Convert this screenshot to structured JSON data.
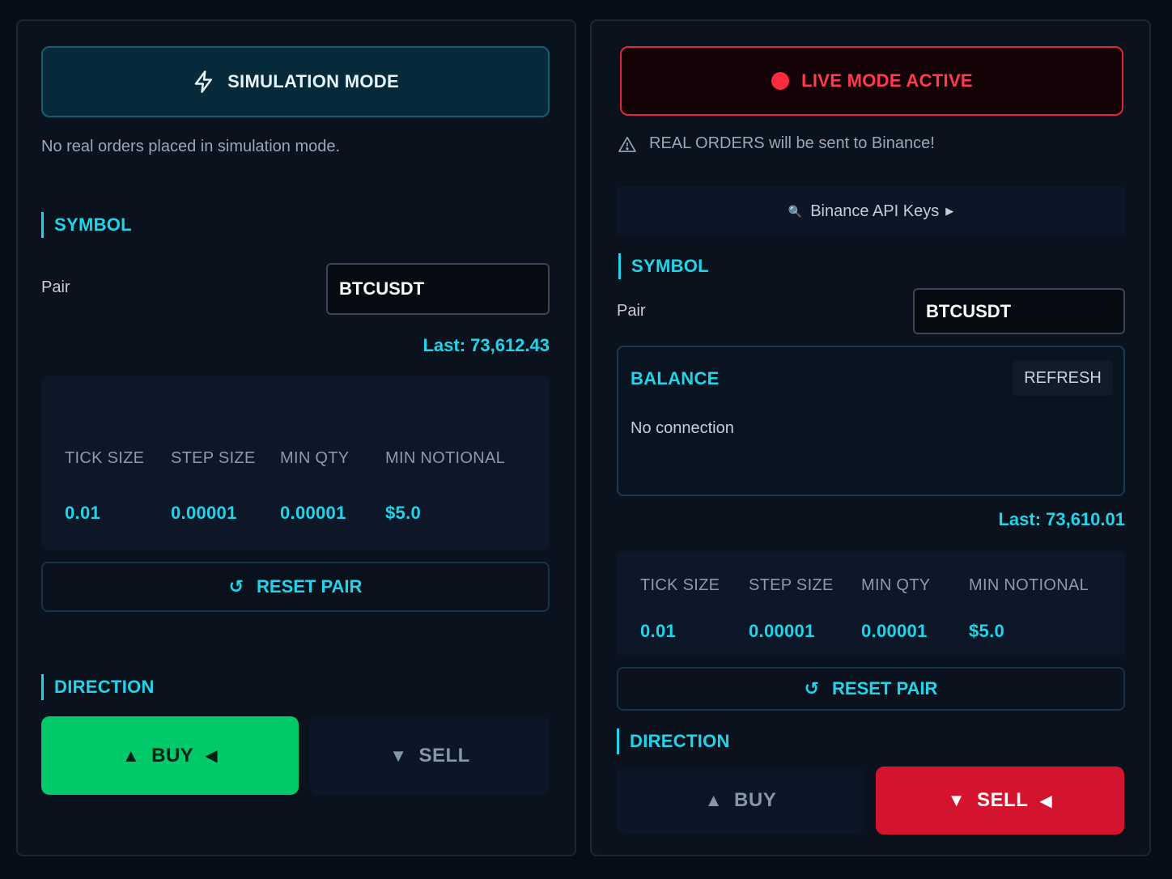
{
  "sim": {
    "mode_label": "SIMULATION MODE",
    "note": "No real orders placed in simulation mode.",
    "symbol_title": "SYMBOL",
    "pair_label": "Pair",
    "pair_value": "BTCUSDT",
    "last": "Last: 73,612.43",
    "info": {
      "headers": [
        "TICK SIZE",
        "STEP SIZE",
        "MIN QTY",
        "MIN NOTIONAL"
      ],
      "values": [
        "0.01",
        "0.00001",
        "0.00001",
        "$5.0"
      ]
    },
    "reset_label": "RESET PAIR",
    "direction_title": "DIRECTION",
    "buy_label": "BUY",
    "sell_label": "SELL",
    "selected_direction": "BUY"
  },
  "live": {
    "mode_label": "LIVE MODE ACTIVE",
    "warning": "REAL ORDERS will be sent to Binance!",
    "api_keys_label": "Binance API Keys",
    "symbol_title": "SYMBOL",
    "pair_label": "Pair",
    "pair_value": "BTCUSDT",
    "balance_title": "BALANCE",
    "refresh_label": "REFRESH",
    "balance_status": "No connection",
    "last": "Last: 73,610.01",
    "info": {
      "headers": [
        "TICK SIZE",
        "STEP SIZE",
        "MIN QTY",
        "MIN NOTIONAL"
      ],
      "values": [
        "0.01",
        "0.00001",
        "0.00001",
        "$5.0"
      ]
    },
    "reset_label": "RESET PAIR",
    "direction_title": "DIRECTION",
    "buy_label": "BUY",
    "sell_label": "SELL",
    "selected_direction": "SELL"
  },
  "colors": {
    "accent": "#20d4ea",
    "buy_active": "#00c96a",
    "sell_active": "#d4142f",
    "live_red": "#ff3b4d"
  },
  "icons": {
    "sim_mode": "lightning-bolt-icon",
    "live_mode": "red-dot-icon",
    "warning": "warning-triangle-icon",
    "api_keys": "key-icon",
    "reset": "refresh-circle-icon"
  }
}
